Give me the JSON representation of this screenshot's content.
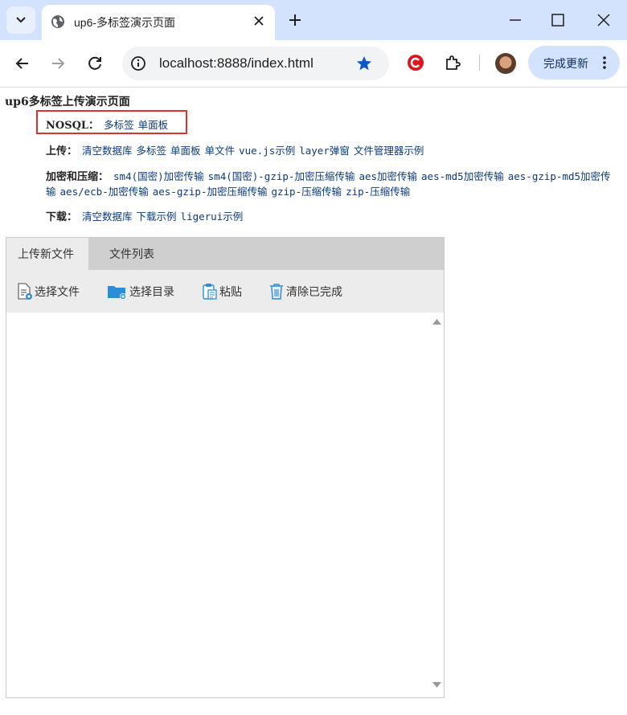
{
  "browser": {
    "tab_title": "up6-多标签演示页面",
    "url": "localhost:8888/index.html",
    "update_label": "完成更新"
  },
  "page": {
    "title": "up6多标签上传演示页面",
    "nosql": {
      "label": "NOSQL：",
      "links": [
        "多标签",
        "单面板"
      ]
    },
    "upload": {
      "label": "上传：",
      "links": [
        "清空数据库",
        "多标签",
        "单面板",
        "单文件",
        "vue.js示例",
        "layer弹窗",
        "文件管理器示例"
      ]
    },
    "encrypt": {
      "label": "加密和压缩：",
      "links": [
        "sm4(国密)加密传输",
        "sm4(国密)-gzip-加密压缩传输",
        "aes加密传输",
        "aes-md5加密传输",
        "aes-gzip-md5加密传输",
        "aes/ecb-加密传输",
        "aes-gzip-加密压缩传输",
        "gzip-压缩传输",
        "zip-压缩传输"
      ]
    },
    "download": {
      "label": "下载：",
      "links": [
        "清空数据库",
        "下载示例",
        "ligerui示例"
      ]
    }
  },
  "uploader": {
    "tabs": [
      "上传新文件",
      "文件列表"
    ],
    "actions": [
      "选择文件",
      "选择目录",
      "粘贴",
      "清除已完成"
    ]
  },
  "colors": {
    "link": "#0b3a7e",
    "highlight_box": "#e03131",
    "accent": "#0b57d0"
  }
}
